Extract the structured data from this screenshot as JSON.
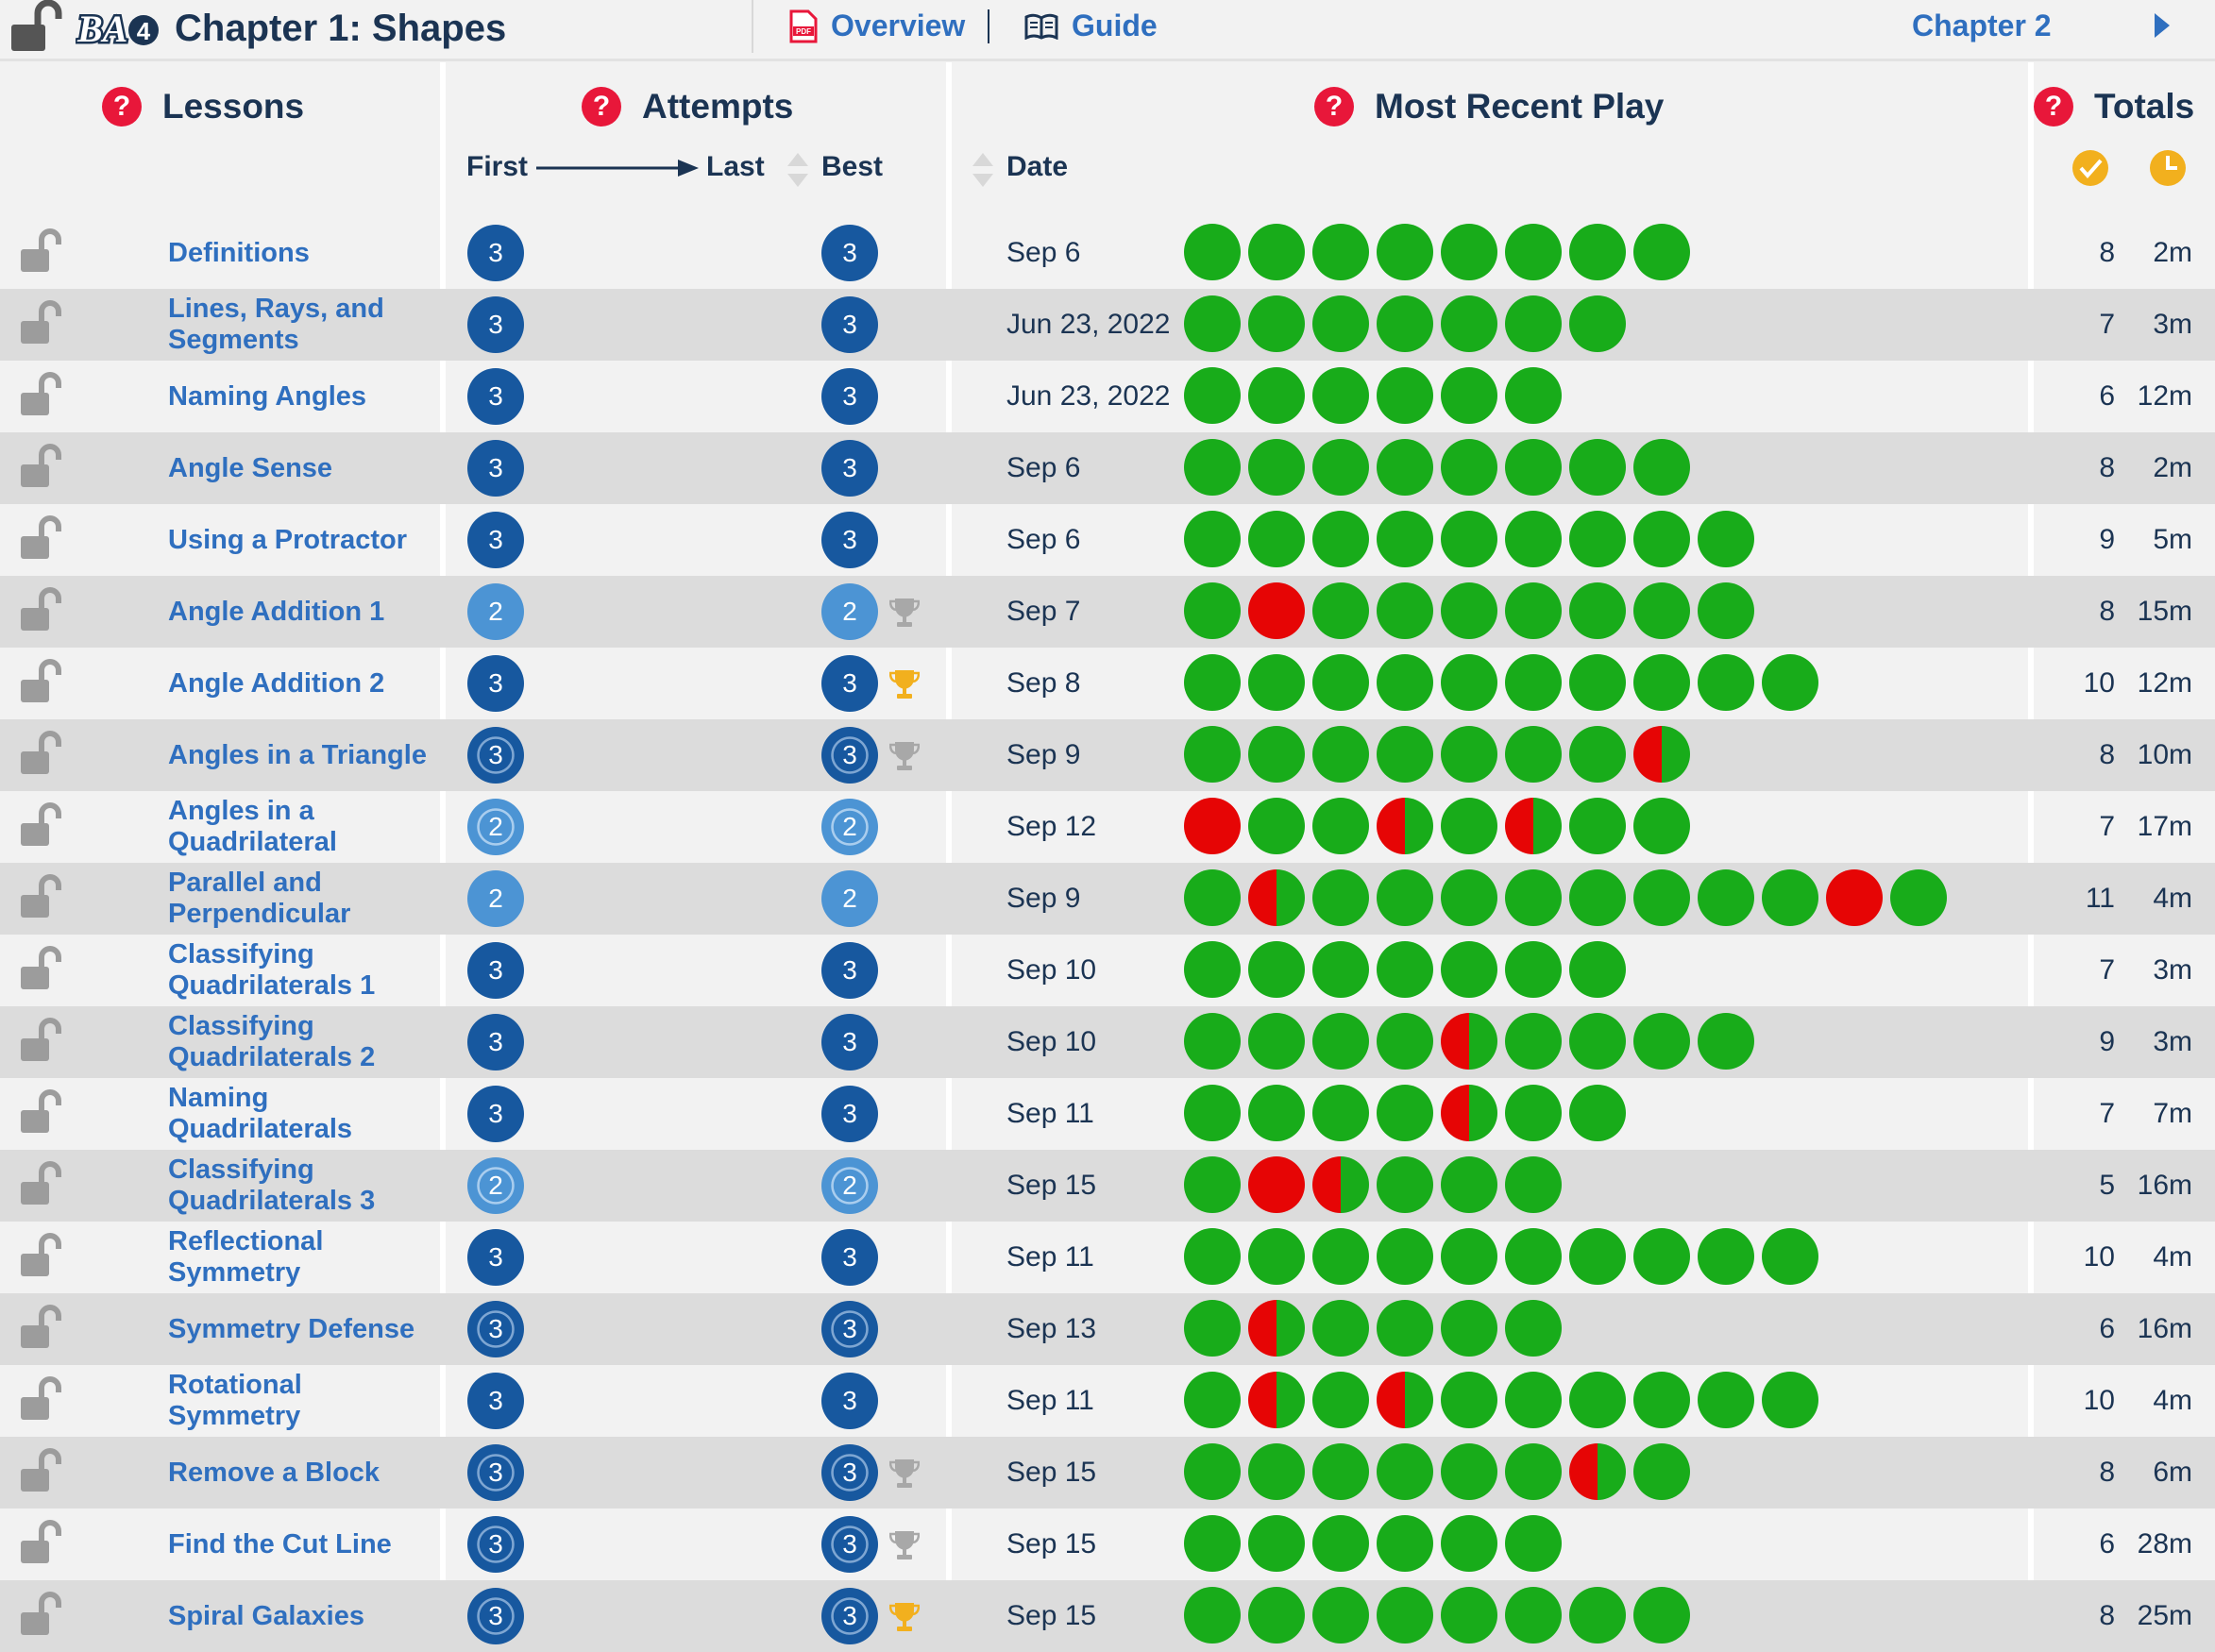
{
  "header": {
    "title": "Chapter 1: Shapes",
    "logo_text": "BA4",
    "overview_label": "Overview",
    "guide_label": "Guide",
    "next_chapter_label": "Chapter 2",
    "pdf_icon_text": "PDF"
  },
  "columns": {
    "lessons": "Lessons",
    "attempts": "Attempts",
    "most_recent_play": "Most Recent Play",
    "totals": "Totals",
    "first": "First",
    "last": "Last",
    "best": "Best",
    "date": "Date",
    "help_glyph": "?"
  },
  "colors": {
    "green": "#18ac1a",
    "red": "#e60505",
    "badge_dark": "#17589f",
    "badge_light": "#4c94d4",
    "link": "#2f6fbf",
    "text": "#1b3453",
    "help": "#e8173a",
    "gold": "#f2b01e"
  },
  "lessons": [
    {
      "name": "Definitions",
      "first": "3",
      "first_style": "dark",
      "best": "3",
      "best_style": "dark",
      "trophy": "none",
      "date": "Sep 6",
      "dots": "gggggggg",
      "count": "8",
      "time": "2m"
    },
    {
      "name": "Lines, Rays, and Segments",
      "first": "3",
      "first_style": "dark",
      "best": "3",
      "best_style": "dark",
      "trophy": "none",
      "date": "Jun 23, 2022",
      "dots": "ggggggg",
      "count": "7",
      "time": "3m"
    },
    {
      "name": "Naming Angles",
      "first": "3",
      "first_style": "dark",
      "best": "3",
      "best_style": "dark",
      "trophy": "none",
      "date": "Jun 23, 2022",
      "dots": "gggggg",
      "count": "6",
      "time": "12m"
    },
    {
      "name": "Angle Sense",
      "first": "3",
      "first_style": "dark",
      "best": "3",
      "best_style": "dark",
      "trophy": "none",
      "date": "Sep 6",
      "dots": "gggggggg",
      "count": "8",
      "time": "2m"
    },
    {
      "name": "Using a Protractor",
      "first": "3",
      "first_style": "dark",
      "best": "3",
      "best_style": "dark",
      "trophy": "none",
      "date": "Sep 6",
      "dots": "ggggggggg",
      "count": "9",
      "time": "5m"
    },
    {
      "name": "Angle Addition 1",
      "first": "2",
      "first_style": "light",
      "best": "2",
      "best_style": "light",
      "trophy": "silver",
      "date": "Sep 7",
      "dots": "grggggggg",
      "count": "8",
      "time": "15m"
    },
    {
      "name": "Angle Addition 2",
      "first": "3",
      "first_style": "dark",
      "best": "3",
      "best_style": "dark",
      "trophy": "gold",
      "date": "Sep 8",
      "dots": "gggggggggg",
      "count": "10",
      "time": "12m"
    },
    {
      "name": "Angles in a Triangle",
      "first": "3",
      "first_style": "dark-gear",
      "best": "3",
      "best_style": "dark-gear",
      "trophy": "silver",
      "date": "Sep 9",
      "dots": "gggggggh",
      "count": "8",
      "time": "10m"
    },
    {
      "name": "Angles in a Quadrilateral",
      "first": "2",
      "first_style": "light-gear",
      "best": "2",
      "best_style": "light-gear",
      "trophy": "none",
      "date": "Sep 12",
      "dots": "rgghghgg",
      "count": "7",
      "time": "17m"
    },
    {
      "name": "Parallel and Perpendicular",
      "first": "2",
      "first_style": "light",
      "best": "2",
      "best_style": "light",
      "trophy": "none",
      "date": "Sep 9",
      "dots": "ghggggggggrg",
      "count": "11",
      "time": "4m"
    },
    {
      "name": "Classifying Quadrilaterals 1",
      "first": "3",
      "first_style": "dark",
      "best": "3",
      "best_style": "dark",
      "trophy": "none",
      "date": "Sep 10",
      "dots": "ggggggg",
      "count": "7",
      "time": "3m"
    },
    {
      "name": "Classifying Quadrilaterals 2",
      "first": "3",
      "first_style": "dark",
      "best": "3",
      "best_style": "dark",
      "trophy": "none",
      "date": "Sep 10",
      "dots": "gggghgggg",
      "count": "9",
      "time": "3m"
    },
    {
      "name": "Naming Quadrilaterals",
      "first": "3",
      "first_style": "dark",
      "best": "3",
      "best_style": "dark",
      "trophy": "none",
      "date": "Sep 11",
      "dots": "gggghgg",
      "count": "7",
      "time": "7m"
    },
    {
      "name": "Classifying Quadrilaterals 3",
      "first": "2",
      "first_style": "light-gear",
      "best": "2",
      "best_style": "light-gear",
      "trophy": "none",
      "date": "Sep 15",
      "dots": "grhggg",
      "count": "5",
      "time": "16m"
    },
    {
      "name": "Reflectional Symmetry",
      "first": "3",
      "first_style": "dark",
      "best": "3",
      "best_style": "dark",
      "trophy": "none",
      "date": "Sep 11",
      "dots": "gggggggggg",
      "count": "10",
      "time": "4m"
    },
    {
      "name": "Symmetry Defense",
      "first": "3",
      "first_style": "dark-gear",
      "best": "3",
      "best_style": "dark-gear",
      "trophy": "none",
      "date": "Sep 13",
      "dots": "ghgggg",
      "count": "6",
      "time": "16m"
    },
    {
      "name": "Rotational Symmetry",
      "first": "3",
      "first_style": "dark",
      "best": "3",
      "best_style": "dark",
      "trophy": "none",
      "date": "Sep 11",
      "dots": "ghghgggggg",
      "count": "10",
      "time": "4m"
    },
    {
      "name": "Remove a Block",
      "first": "3",
      "first_style": "dark-gear",
      "best": "3",
      "best_style": "dark-gear",
      "trophy": "silver",
      "date": "Sep 15",
      "dots": "gggggghg",
      "count": "8",
      "time": "6m"
    },
    {
      "name": "Find the Cut Line",
      "first": "3",
      "first_style": "dark-gear",
      "best": "3",
      "best_style": "dark-gear",
      "trophy": "silver",
      "date": "Sep 15",
      "dots": "gggggg",
      "count": "6",
      "time": "28m"
    },
    {
      "name": "Spiral Galaxies",
      "first": "3",
      "first_style": "dark-gear",
      "best": "3",
      "best_style": "dark-gear",
      "trophy": "gold",
      "date": "Sep 15",
      "dots": "gggggggg",
      "count": "8",
      "time": "25m"
    }
  ]
}
